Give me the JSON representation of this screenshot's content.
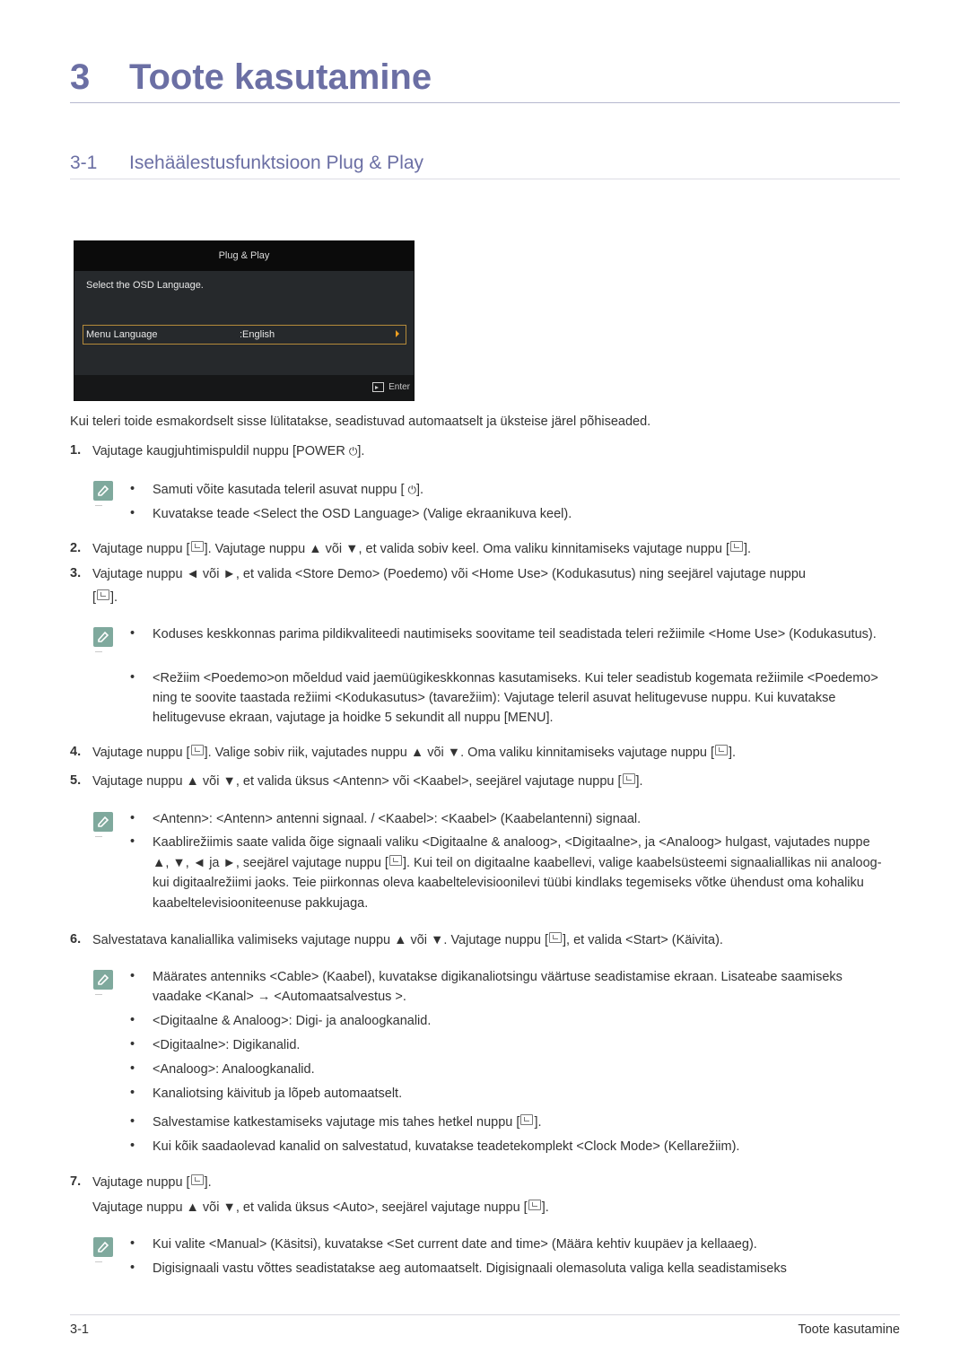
{
  "chapter": {
    "number": "3",
    "title": "Toote kasutamine"
  },
  "section": {
    "number": "3-1",
    "title": "Isehäälestusfunktsioon Plug & Play"
  },
  "osd": {
    "title": "Plug & Play",
    "prompt": "Select the OSD Language.",
    "row_label": "Menu Language",
    "row_value": ":English",
    "enter_label": "Enter"
  },
  "intro": "Kui teleri toide esmakordselt sisse lülitatakse, seadistuvad automaatselt ja üksteise järel põhiseaded.",
  "steps": {
    "s1": {
      "num": "1.",
      "text_a": "Vajutage kaugjuhtimispuldil nuppu [POWER ",
      "text_b": "]."
    },
    "n1": [
      {
        "a": "Samuti võite kasutada teleril asuvat nuppu [ ",
        "b": "]."
      },
      "Kuvatakse teade <Select the OSD Language> (Valige ekraanikuva keel)."
    ],
    "s2": {
      "num": "2.",
      "a": "Vajutage nuppu [",
      "b": "]. Vajutage nuppu ▲ või ▼, et valida sobiv keel. Oma valiku kinnitamiseks vajutage nuppu [",
      "c": "]."
    },
    "s3": {
      "num": "3.",
      "a": "Vajutage nuppu ◄ või ►, et valida <Store Demo> (Poedemo) või <Home Use> (Kodukasutus) ning seejärel vajutage nuppu",
      "b": "[",
      "c": "]."
    },
    "n3": [
      "Koduses keskkonnas parima pildikvaliteedi nautimiseks soovitame teil seadistada teleri režiimile <Home Use> (Kodukasutus).",
      "<Režiim <Poedemo>on mõeldud vaid jaemüügikeskkonnas kasutamiseks. Kui teler seadistub kogemata režiimile <Poedemo> ning te soovite taastada režiimi <Kodukasutus> (tavarežiim): Vajutage teleril asuvat helitugevuse nuppu. Kui kuvatakse helitugevuse ekraan, vajutage ja hoidke 5 sekundit all nuppu [MENU]."
    ],
    "s4": {
      "num": "4.",
      "a": "Vajutage nuppu [",
      "b": "]. Valige sobiv riik, vajutades nuppu ▲ või ▼. Oma valiku kinnitamiseks vajutage nuppu [",
      "c": "]."
    },
    "s5": {
      "num": "5.",
      "a": "Vajutage nuppu ▲ või ▼, et valida üksus <Antenn> või <Kaabel>, seejärel vajutage nuppu [",
      "b": "]."
    },
    "n5": [
      "<Antenn>: <Antenn> antenni signaal. / <Kaabel>: <Kaabel> (Kaabelantenni) signaal.",
      {
        "a": "Kaablirežiimis saate valida õige signaali valiku <Digitaalne & analoog>, <Digitaalne>, ja <Analoog> hulgast, vajutades nuppe ▲, ▼, ◄ ja ►, seejärel vajutage nuppu [",
        "b": "]. Kui teil on digitaalne kaabellevi, valige kaabelsüsteemi signaaliallikas nii analoog- kui digitaalrežiimi jaoks. Teie piirkonnas oleva kaabeltelevisioonilevi tüübi kindlaks tegemiseks võtke ühendust oma kohaliku kaabeltelevisiooniteenuse pakkujaga."
      }
    ],
    "s6": {
      "num": "6.",
      "a": "Salvestatava kanaliallika valimiseks vajutage nuppu ▲ või ▼. Vajutage nuppu [",
      "b": "], et valida <Start> (Käivita)."
    },
    "n6": [
      "Määrates antenniks <Cable> (Kaabel), kuvatakse digikanaliotsingu väärtuse seadistamise ekraan. Lisateabe saamiseks vaadake <Kanal> → <Automaatsalvestus >.",
      "<Digitaalne & Analoog>: Digi- ja analoogkanalid.",
      "<Digitaalne>: Digikanalid.",
      "<Analoog>: Analoogkanalid.",
      "Kanaliotsing käivitub ja lõpeb automaatselt.",
      {
        "a": "Salvestamise katkestamiseks vajutage mis tahes hetkel nuppu [",
        "b": "]."
      },
      "Kui kõik saadaolevad kanalid on salvestatud, kuvatakse teadetekomplekt <Clock Mode> (Kellarežiim)."
    ],
    "s7": {
      "num": "7.",
      "a": "Vajutage nuppu [",
      "b": "].",
      "c": "Vajutage nuppu ▲ või ▼, et valida üksus <Auto>, seejärel vajutage nuppu [",
      "d": "]."
    },
    "n7": [
      "Kui valite <Manual> (Käsitsi), kuvatakse <Set current date and time> (Määra kehtiv kuupäev ja kellaaeg).",
      "Digisignaali vastu võttes seadistatakse aeg automaatselt. Digisignaali olemasoluta valiga kella seadistamiseks"
    ]
  },
  "bullet_char": "•",
  "power_symbol": "⏻",
  "footer": {
    "page": "3-1",
    "chapter": "Toote kasutamine"
  }
}
